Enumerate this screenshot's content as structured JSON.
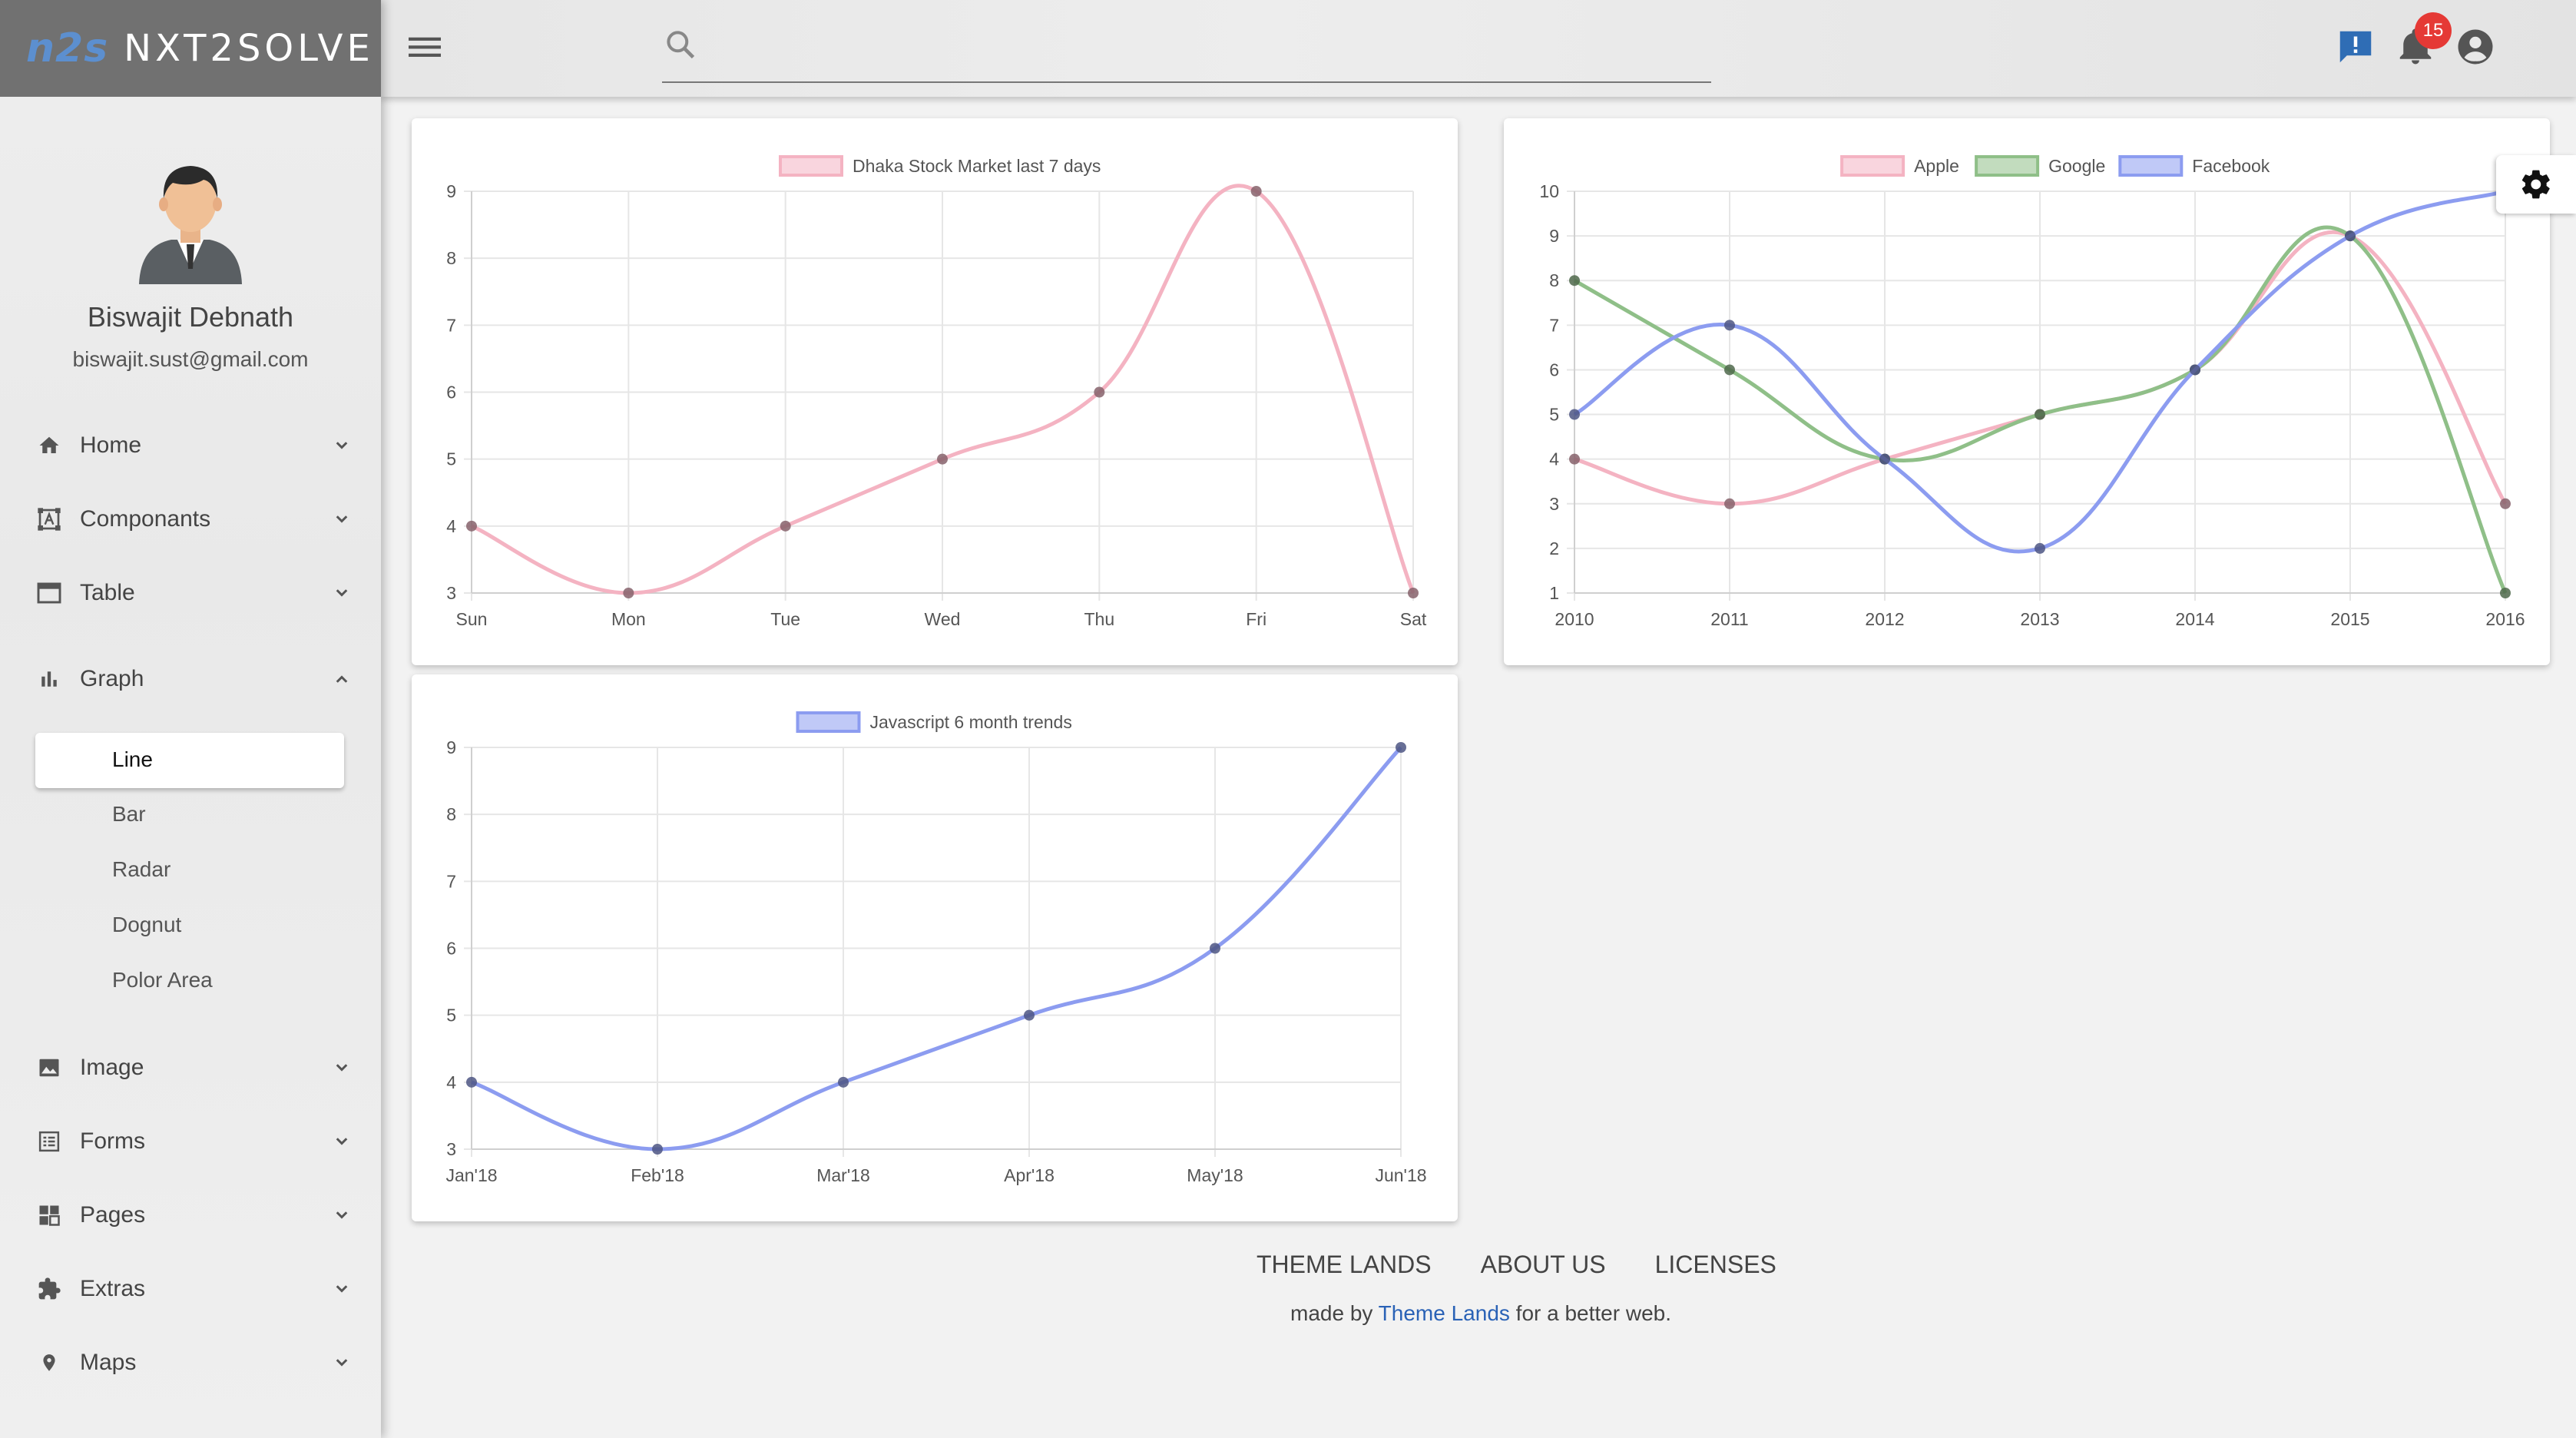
{
  "brand": {
    "logo": "n2s",
    "name": "NXT2SOLVE"
  },
  "user": {
    "name": "Biswajit Debnath",
    "email": "biswajit.sust@gmail.com"
  },
  "sidebar": {
    "items": [
      {
        "label": "Home",
        "icon": "home-icon"
      },
      {
        "label": "Componants",
        "icon": "components-icon"
      },
      {
        "label": "Table",
        "icon": "table-icon"
      },
      {
        "label": "Graph",
        "icon": "bar-chart-icon"
      },
      {
        "label": "Image",
        "icon": "image-icon"
      },
      {
        "label": "Forms",
        "icon": "form-icon"
      },
      {
        "label": "Pages",
        "icon": "pages-icon"
      },
      {
        "label": "Extras",
        "icon": "puzzle-icon"
      },
      {
        "label": "Maps",
        "icon": "map-pin-icon"
      }
    ],
    "graph_submenu": [
      "Line",
      "Bar",
      "Radar",
      "Dognut",
      "Polor Area"
    ],
    "active_submenu": "Line"
  },
  "topbar": {
    "search_placeholder": "",
    "notification_count": "15"
  },
  "chart_data": [
    {
      "type": "line",
      "categories": [
        "Sun",
        "Mon",
        "Tue",
        "Wed",
        "Thu",
        "Fri",
        "Sat"
      ],
      "series": [
        {
          "name": "Dhaka Stock Market last 7 days",
          "values": [
            4,
            3,
            4,
            5,
            6,
            9,
            3
          ],
          "color": "#f4b3c2"
        }
      ],
      "ylim": [
        3,
        9
      ],
      "yticks": [
        3,
        4,
        5,
        6,
        7,
        8,
        9
      ],
      "legend": "top",
      "grid": true
    },
    {
      "type": "line",
      "categories": [
        "2010",
        "2011",
        "2012",
        "2013",
        "2014",
        "2015",
        "2016"
      ],
      "series": [
        {
          "name": "Apple",
          "values": [
            4,
            3,
            4,
            5,
            6,
            9,
            3
          ],
          "color": "#f4b3c2"
        },
        {
          "name": "Google",
          "values": [
            8,
            6,
            4,
            5,
            6,
            9,
            1
          ],
          "color": "#8fbf88"
        },
        {
          "name": "Facebook",
          "values": [
            5,
            7,
            4,
            2,
            6,
            9,
            10
          ],
          "color": "#8c9cf0"
        }
      ],
      "ylim": [
        1,
        10
      ],
      "yticks": [
        1,
        2,
        3,
        4,
        5,
        6,
        7,
        8,
        9,
        10
      ],
      "legend": "top",
      "grid": true
    },
    {
      "type": "line",
      "categories": [
        "Jan'18",
        "Feb'18",
        "Mar'18",
        "Apr'18",
        "May'18",
        "Jun'18"
      ],
      "series": [
        {
          "name": "Javascript 6 month trends",
          "values": [
            4,
            3,
            4,
            5,
            6,
            9
          ],
          "color": "#8c9cf0"
        }
      ],
      "ylim": [
        3,
        9
      ],
      "yticks": [
        3,
        4,
        5,
        6,
        7,
        8,
        9
      ],
      "legend": "top",
      "grid": true
    }
  ],
  "footer": {
    "links": [
      "THEME LANDS",
      "ABOUT US",
      "LICENSES"
    ],
    "credit_prefix": "made by ",
    "credit_link": "Theme Lands",
    "credit_suffix": " for a better web."
  }
}
